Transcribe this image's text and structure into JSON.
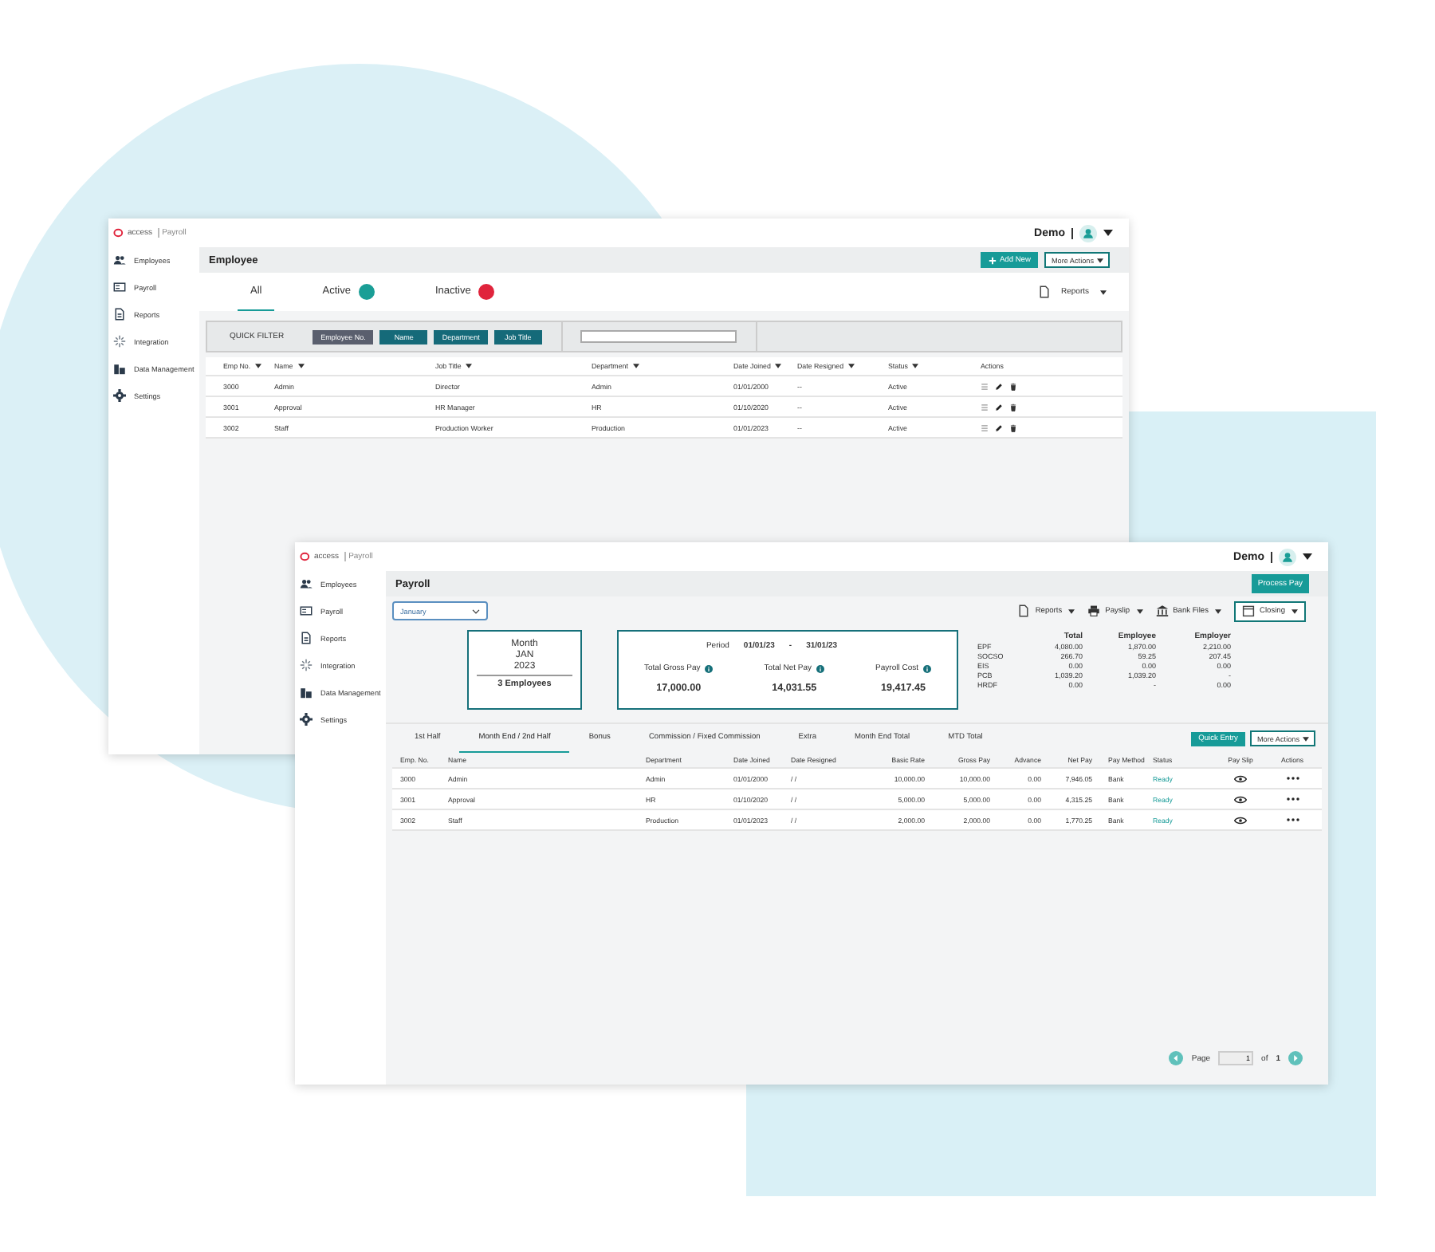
{
  "back_window": {
    "brand": "access",
    "product": "Payroll",
    "user": "Demo",
    "sidebar": [
      {
        "label": "Employees",
        "kind": "people"
      },
      {
        "label": "Payroll",
        "kind": "card"
      },
      {
        "label": "Reports",
        "kind": "document"
      },
      {
        "label": "Integration",
        "kind": "sparkle"
      },
      {
        "label": "Data Management",
        "kind": "building"
      },
      {
        "label": "Settings",
        "kind": "gear"
      }
    ],
    "page_title": "Employee",
    "add_button": "Add New",
    "more_actions": "More Actions",
    "tabs": [
      {
        "label": "All",
        "selected": true
      },
      {
        "label": "Active",
        "selected": false,
        "color": "#1a9e96"
      },
      {
        "label": "Inactive",
        "selected": false,
        "color": "#e0243c"
      }
    ],
    "reports": "Reports",
    "quick_filter": {
      "label": "QUICK FILTER",
      "chips": [
        {
          "label": "Employee No.",
          "selected": true
        },
        {
          "label": "Name",
          "selected": false
        },
        {
          "label": "Department",
          "selected": false
        },
        {
          "label": "Job Title",
          "selected": false
        }
      ]
    },
    "table": {
      "columns": [
        "Emp No.",
        "Name",
        "Job Title",
        "Department",
        "Date Joined",
        "Date Resigned",
        "Status",
        "Actions"
      ],
      "rows": [
        [
          "3000",
          "Admin",
          "Director",
          "Admin",
          "01/01/2000",
          "--",
          "Active"
        ],
        [
          "3001",
          "Approval",
          "HR Manager",
          "HR",
          "01/10/2020",
          "--",
          "Active"
        ],
        [
          "3002",
          "Staff",
          "Production Worker",
          "Production",
          "01/01/2023",
          "--",
          "Active"
        ]
      ]
    }
  },
  "front_window": {
    "brand": "access",
    "product": "Payroll",
    "user": "Demo",
    "sidebar": [
      {
        "label": "Employees",
        "kind": "people"
      },
      {
        "label": "Payroll",
        "kind": "card"
      },
      {
        "label": "Reports",
        "kind": "document"
      },
      {
        "label": "Integration",
        "kind": "sparkle"
      },
      {
        "label": "Data Management",
        "kind": "building"
      },
      {
        "label": "Settings",
        "kind": "gear"
      }
    ],
    "page_title": "Payroll",
    "process_button": "Process Pay",
    "month_select": "January",
    "toolbar": [
      {
        "label": "Reports",
        "kind": "document"
      },
      {
        "label": "Payslip",
        "kind": "printer"
      },
      {
        "label": "Bank Files",
        "kind": "bank"
      },
      {
        "label": "Closing",
        "kind": "calendar"
      }
    ],
    "month_card": {
      "label": "Month",
      "month": "JAN",
      "year": "2023",
      "employees": "3 Employees"
    },
    "period": {
      "label": "Period",
      "start": "01/01/23",
      "separator": "-",
      "end": "31/01/23",
      "totals": [
        {
          "label": "Total Gross Pay",
          "value": "17,000.00"
        },
        {
          "label": "Total Net Pay",
          "value": "14,031.55"
        },
        {
          "label": "Payroll Cost",
          "value": "19,417.45"
        }
      ]
    },
    "contributions": {
      "columns": [
        "Total",
        "Employee",
        "Employer"
      ],
      "rows": [
        {
          "name": "EPF",
          "values": [
            "4,080.00",
            "1,870.00",
            "2,210.00"
          ]
        },
        {
          "name": "SOCSO",
          "values": [
            "266.70",
            "59.25",
            "207.45"
          ]
        },
        {
          "name": "EIS",
          "values": [
            "0.00",
            "0.00",
            "0.00"
          ]
        },
        {
          "name": "PCB",
          "values": [
            "1,039.20",
            "1,039.20",
            "-"
          ]
        },
        {
          "name": "HRDF",
          "values": [
            "0.00",
            "-",
            "0.00"
          ]
        }
      ]
    },
    "tabs": [
      {
        "label": "1st Half",
        "selected": false
      },
      {
        "label": "Month End / 2nd Half",
        "selected": true
      },
      {
        "label": "Bonus",
        "selected": false
      },
      {
        "label": "Commission / Fixed Commission",
        "selected": false
      },
      {
        "label": "Extra",
        "selected": false
      },
      {
        "label": "Month End Total",
        "selected": false
      },
      {
        "label": "MTD Total",
        "selected": false
      }
    ],
    "quick_entry": "Quick Entry",
    "more_actions": "More Actions",
    "table": {
      "columns": [
        "Emp. No.",
        "Name",
        "Department",
        "Date Joined",
        "Date Resigned",
        "Basic Rate",
        "Gross Pay",
        "Advance",
        "Net Pay",
        "Pay Method",
        "Status",
        "Pay Slip",
        "Actions"
      ],
      "rows": [
        [
          "3000",
          "Admin",
          "Admin",
          "01/01/2000",
          "/ /",
          "10,000.00",
          "10,000.00",
          "0.00",
          "7,946.05",
          "Bank",
          "Ready"
        ],
        [
          "3001",
          "Approval",
          "HR",
          "01/10/2020",
          "/ /",
          "5,000.00",
          "5,000.00",
          "0.00",
          "4,315.25",
          "Bank",
          "Ready"
        ],
        [
          "3002",
          "Staff",
          "Production",
          "01/01/2023",
          "/ /",
          "2,000.00",
          "2,000.00",
          "0.00",
          "1,770.25",
          "Bank",
          "Ready"
        ]
      ]
    },
    "pagination": {
      "label": "Page",
      "value": "1",
      "of": "of",
      "total": "1"
    }
  }
}
